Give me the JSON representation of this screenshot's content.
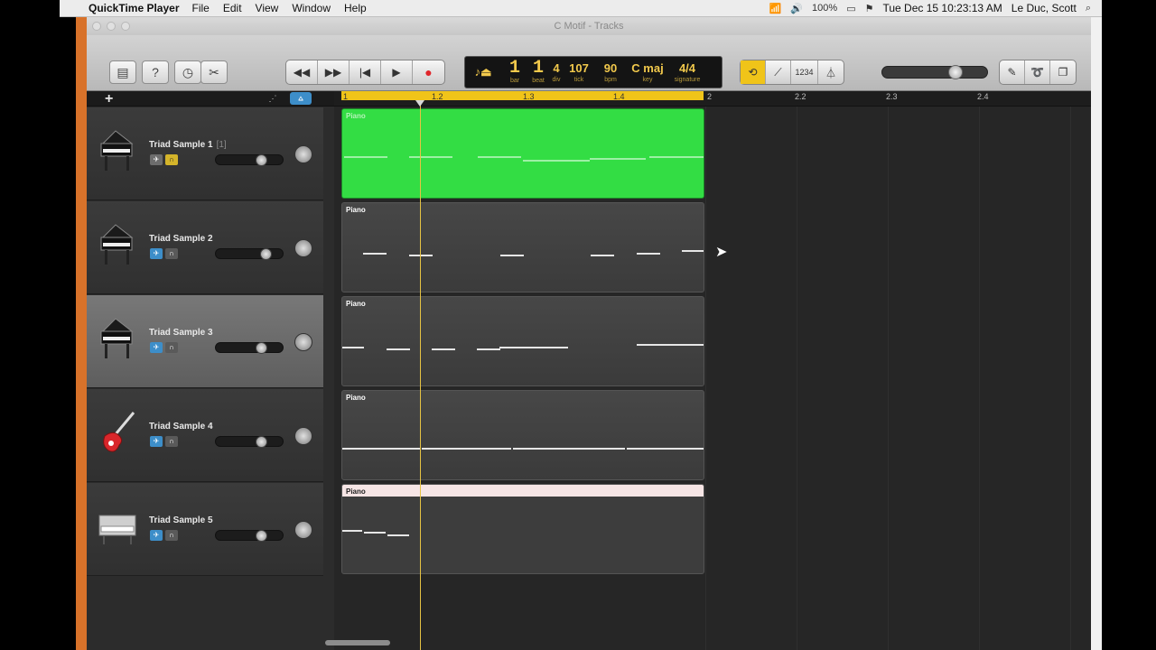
{
  "menubar": {
    "app_name": "QuickTime Player",
    "menus": [
      "File",
      "Edit",
      "View",
      "Window",
      "Help"
    ],
    "battery": "100%",
    "clock": "Tue Dec 15  10:23:13 AM",
    "user": "Le Duc, Scott"
  },
  "window": {
    "title": "C Motif - Tracks"
  },
  "lcd": {
    "bar": "1",
    "bar_label": "bar",
    "beat": "1",
    "beat_label": "beat",
    "div": "4",
    "div_label": "div",
    "tick": "107",
    "tick_label": "tick",
    "bpm": "90",
    "bpm_label": "bpm",
    "key": "C maj",
    "key_label": "key",
    "signature": "4/4",
    "signature_label": "signature"
  },
  "toolbar": {
    "count_in_label": "1234",
    "master_volume": 0.7
  },
  "ruler": {
    "ticks": [
      "1",
      "1.2",
      "1.3",
      "1.4",
      "2",
      "2.2",
      "2.3",
      "2.4"
    ]
  },
  "tracks": [
    {
      "name": "Triad Sample 1",
      "index": "[1]",
      "instrument": "grand-piano",
      "muted": false,
      "solo": true,
      "volume": 0.68,
      "selected": false,
      "region_label": "Piano",
      "region_style": "green"
    },
    {
      "name": "Triad Sample 2",
      "index": "",
      "instrument": "grand-piano",
      "muted": true,
      "solo": false,
      "volume": 0.75,
      "selected": false,
      "region_label": "Piano",
      "region_style": "dark"
    },
    {
      "name": "Triad Sample 3",
      "index": "",
      "instrument": "grand-piano",
      "muted": true,
      "solo": false,
      "volume": 0.68,
      "selected": true,
      "region_label": "Piano",
      "region_style": "dark"
    },
    {
      "name": "Triad Sample 4",
      "index": "",
      "instrument": "electric-guitar",
      "muted": true,
      "solo": false,
      "volume": 0.68,
      "selected": false,
      "region_label": "Piano",
      "region_style": "dark"
    },
    {
      "name": "Triad Sample 5",
      "index": "",
      "instrument": "electric-piano",
      "muted": true,
      "solo": false,
      "volume": 0.68,
      "selected": false,
      "region_label": "Piano",
      "region_style": "light"
    }
  ],
  "colors": {
    "cycle": "#f0c419",
    "selected_region": "#33dd44",
    "playhead": "#e6c343",
    "window_edge": "#d8722a"
  }
}
